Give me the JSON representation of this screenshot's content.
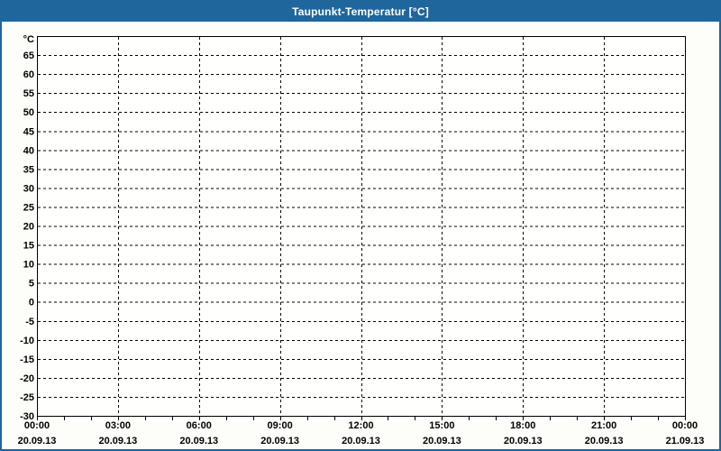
{
  "window": {
    "title": "Taupunkt-Temperatur [°C]"
  },
  "colors": {
    "titlebar_bg": "#1f669c",
    "titlebar_text": "#ffffff",
    "window_border": "#1f669c",
    "chart_bg": "#fdfdfa",
    "plot_bg": "#fffffe",
    "grid": "#000000",
    "axis": "#000000",
    "label": "#000000"
  },
  "chart_data": {
    "type": "line",
    "title": "Taupunkt-Temperatur [°C]",
    "ylabel": "°C",
    "xlabel": "",
    "ylim": [
      -30,
      70
    ],
    "ytick_step": 5,
    "yticks": [
      65,
      60,
      55,
      50,
      45,
      40,
      35,
      30,
      25,
      20,
      15,
      10,
      5,
      0,
      -5,
      -10,
      -15,
      -20,
      -25,
      -30
    ],
    "x_total_hours": 24,
    "x_minor_tick_interval_hours": 1,
    "x_major_tick_interval_hours": 3,
    "x_major_ticks": [
      {
        "time": "00:00",
        "date": "20.09.13"
      },
      {
        "time": "03:00",
        "date": "20.09.13"
      },
      {
        "time": "06:00",
        "date": "20.09.13"
      },
      {
        "time": "09:00",
        "date": "20.09.13"
      },
      {
        "time": "12:00",
        "date": "20.09.13"
      },
      {
        "time": "15:00",
        "date": "20.09.13"
      },
      {
        "time": "18:00",
        "date": "20.09.13"
      },
      {
        "time": "21:00",
        "date": "20.09.13"
      },
      {
        "time": "00:00",
        "date": "21.09.13"
      }
    ],
    "grid_style": "dashed",
    "legend": null,
    "series": []
  }
}
